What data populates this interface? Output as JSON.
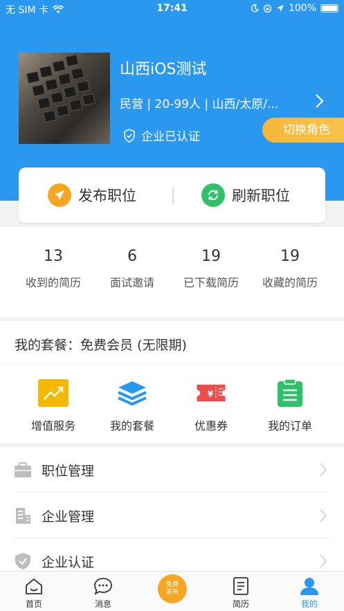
{
  "status_bar": {
    "carrier": "无 SIM 卡",
    "time": "17:41",
    "battery": "100%"
  },
  "company": {
    "name": "山西iOS测试",
    "info": "民营 | 20-99人 | 山西/太原/...",
    "verified_label": "企业已认证",
    "switch_role_label": "切换角色"
  },
  "actions": {
    "publish_label": "发布职位",
    "refresh_label": "刷新职位"
  },
  "stats": [
    {
      "num": "13",
      "label": "收到的简历"
    },
    {
      "num": "6",
      "label": "面试邀请"
    },
    {
      "num": "19",
      "label": "已下载简历"
    },
    {
      "num": "19",
      "label": "收藏的简历"
    }
  ],
  "package": {
    "title": "我的套餐：免费会员 (无限期)",
    "items": [
      {
        "label": "增值服务",
        "icon": "trend-icon",
        "color": "#f5b800"
      },
      {
        "label": "我的套餐",
        "icon": "layers-icon",
        "color": "#2b98f0"
      },
      {
        "label": "优惠券",
        "icon": "coupon-icon",
        "color": "#ef4b4b"
      },
      {
        "label": "我的订单",
        "icon": "clipboard-icon",
        "color": "#2fc06a"
      }
    ]
  },
  "menu": [
    {
      "label": "职位管理",
      "icon": "briefcase-icon"
    },
    {
      "label": "企业管理",
      "icon": "building-icon"
    },
    {
      "label": "企业认证",
      "icon": "shield-check-icon"
    }
  ],
  "tabbar": {
    "home": "首页",
    "messages": "消息",
    "free_publish_line1": "免费",
    "free_publish_line2": "发布",
    "resume": "简历",
    "mine": "我的"
  },
  "colors": {
    "primary": "#2b98f0",
    "accent": "#f5b800",
    "green": "#2fc06a",
    "red": "#ef4b4b"
  }
}
